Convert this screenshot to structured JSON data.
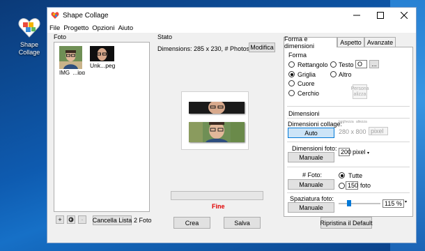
{
  "desktop": {
    "icon_label": "Shape Collage"
  },
  "window": {
    "title": "Shape Collage",
    "menu": [
      "File",
      "Progetto",
      "Opzioni",
      "Aiuto"
    ]
  },
  "photos": {
    "header": "Foto",
    "items": [
      {
        "label": "IMG_...jpg"
      },
      {
        "label": "Unk...peg"
      }
    ],
    "add_tooltip": "+",
    "clear_button": "Cancella Lista",
    "count": "2 Foto"
  },
  "status": {
    "header": "Stato",
    "dimensions": "Dimensions: 285 x 230, # Photos: 2",
    "modify_button": "Modifica",
    "progress": 0,
    "state": "Fine",
    "create_button": "Crea",
    "save_button": "Salva"
  },
  "settings": {
    "tabs": [
      "Forma e dimensioni",
      "Aspetto",
      "Avanzate"
    ],
    "shape": {
      "header": "Forma",
      "options": [
        "Rettangolo",
        "Griglia",
        "Cuore",
        "Cerchio",
        "Testo",
        "Altro"
      ],
      "selected": "Griglia",
      "text_value": "O",
      "browse": "...",
      "shape_button": "Persona alizza"
    },
    "dimensions": {
      "header": "Dimensioni",
      "collage_label": "Dimensioni collage:",
      "collage_button": "Auto",
      "width_caption": "larghezza",
      "height_caption": "altezza",
      "collage_size": "280 x 800",
      "collage_unit": "pixel",
      "photo_label": "Dimensioni foto:",
      "photo_button": "Manuale",
      "photo_size": "200",
      "photo_unit": "pixel",
      "count_label": "# Foto:",
      "count_button": "Manuale",
      "count_all": "Tutte",
      "count_value": "150",
      "count_unit": "foto",
      "spacing_label": "Spaziatura foto:",
      "spacing_button": "Manuale",
      "spacing_value": "115 %",
      "spacing_level": 0.2
    },
    "reset_button": "Ripristina il Default"
  },
  "colors": {
    "accent": "#0078d7",
    "status_red": "#e00000"
  }
}
